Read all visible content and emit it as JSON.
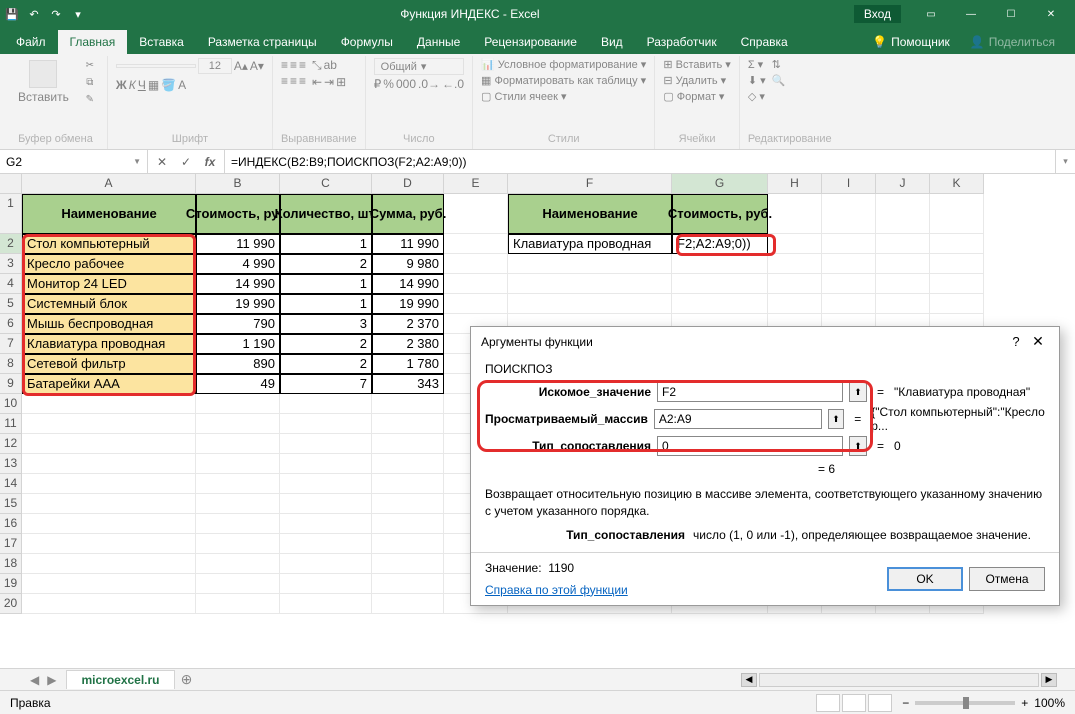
{
  "titlebar": {
    "title": "Функция ИНДЕКС  -  Excel",
    "login": "Вход"
  },
  "tabs": {
    "file": "Файл",
    "home": "Главная",
    "insert": "Вставка",
    "layout": "Разметка страницы",
    "formulas": "Формулы",
    "data": "Данные",
    "review": "Рецензирование",
    "view": "Вид",
    "developer": "Разработчик",
    "help": "Справка",
    "assistant": "Помощник",
    "share": "Поделиться"
  },
  "ribbon": {
    "clipboard": {
      "paste": "Вставить",
      "label": "Буфер обмена"
    },
    "font": {
      "label": "Шрифт",
      "size": "12"
    },
    "alignment": {
      "label": "Выравнивание"
    },
    "number": {
      "format": "Общий",
      "label": "Число"
    },
    "styles": {
      "cf": "Условное форматирование",
      "table": "Форматировать как таблицу",
      "cells": "Стили ячеек",
      "label": "Стили"
    },
    "cells_grp": {
      "insert": "Вставить",
      "delete": "Удалить",
      "format": "Формат",
      "label": "Ячейки"
    },
    "editing": {
      "label": "Редактирование"
    }
  },
  "formula_bar": {
    "name_box": "G2",
    "formula": "=ИНДЕКС(B2:B9;ПОИСКПОЗ(F2;A2:A9;0))"
  },
  "columns": [
    "A",
    "B",
    "C",
    "D",
    "E",
    "F",
    "G",
    "H",
    "I",
    "J",
    "K"
  ],
  "row_numbers": [
    "1",
    "2",
    "3",
    "4",
    "5",
    "6",
    "7",
    "8",
    "9",
    "10",
    "11",
    "12",
    "13",
    "14",
    "15",
    "16",
    "17",
    "18",
    "19",
    "20"
  ],
  "headers": {
    "a1": "Наименование",
    "b1": "Стоимость, руб.",
    "c1": "Количество, шт.",
    "d1": "Сумма, руб.",
    "f1": "Наименование",
    "g1": "Стоимость, руб."
  },
  "rows": [
    {
      "a": "Стол компьютерный",
      "b": "11 990",
      "c": "1",
      "d": "11 990"
    },
    {
      "a": "Кресло рабочее",
      "b": "4 990",
      "c": "2",
      "d": "9 980"
    },
    {
      "a": "Монитор 24 LED",
      "b": "14 990",
      "c": "1",
      "d": "14 990"
    },
    {
      "a": "Системный блок",
      "b": "19 990",
      "c": "1",
      "d": "19 990"
    },
    {
      "a": "Мышь беспроводная",
      "b": "790",
      "c": "3",
      "d": "2 370"
    },
    {
      "a": "Клавиатура проводная",
      "b": "1 190",
      "c": "2",
      "d": "2 380"
    },
    {
      "a": "Сетевой фильтр",
      "b": "890",
      "c": "2",
      "d": "1 780"
    },
    {
      "a": "Батарейки AAA",
      "b": "49",
      "c": "7",
      "d": "343"
    }
  ],
  "lookup": {
    "f2": "Клавиатура проводная",
    "g2": "F2;A2:A9;0))"
  },
  "dialog": {
    "title": "Аргументы функции",
    "func": "ПОИСКПОЗ",
    "args": {
      "lookup_value": {
        "label": "Искомое_значение",
        "value": "F2",
        "result": "\"Клавиатура проводная\""
      },
      "lookup_array": {
        "label": "Просматриваемый_массив",
        "value": "A2:A9",
        "result": "{\"Стол компьютерный\":\"Кресло р..."
      },
      "match_type": {
        "label": "Тип_сопоставления",
        "value": "0",
        "result": "0"
      }
    },
    "result_eq": "= 6",
    "desc": "Возвращает относительную позицию в массиве элемента, соответствующего указанному значению с учетом указанного порядка.",
    "arg_desc_label": "Тип_сопоставления",
    "arg_desc_text": "число (1, 0 или -1), определяющее возвращаемое значение.",
    "value_label": "Значение:",
    "value": "1190",
    "help": "Справка по этой функции",
    "ok": "OK",
    "cancel": "Отмена"
  },
  "sheet": {
    "name": "microexcel.ru"
  },
  "status": {
    "mode": "Правка",
    "zoom": "100%"
  }
}
